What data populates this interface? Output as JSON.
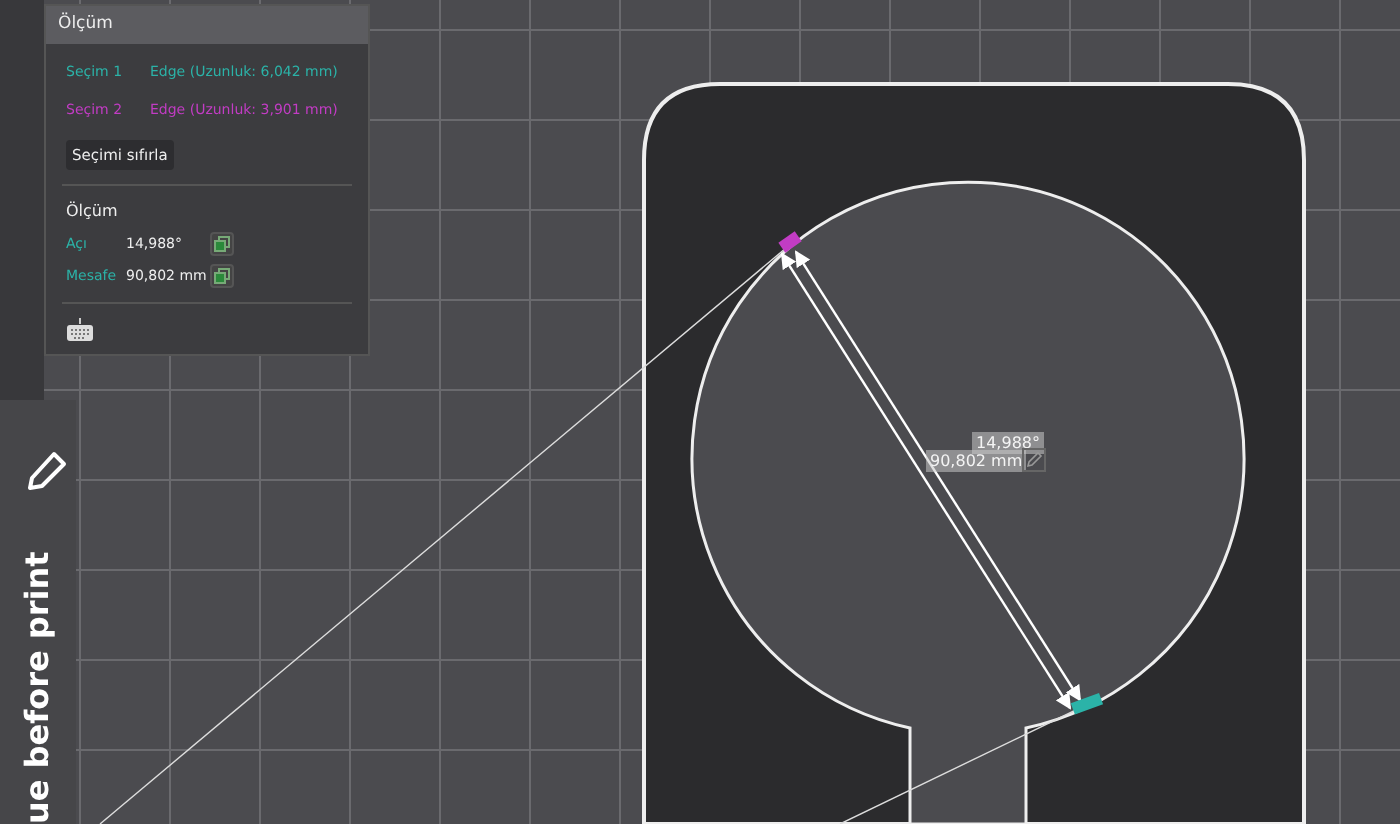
{
  "panel": {
    "title": "Ölçüm",
    "selections": [
      {
        "label": "Seçim 1",
        "value": "Edge (Uzunluk: 6,042 mm)",
        "color": "#2bb3a8"
      },
      {
        "label": "Seçim 2",
        "value": "Edge (Uzunluk: 3,901 mm)",
        "color": "#c23cc4"
      }
    ],
    "reset_button": "Seçimi sıfırla",
    "section_title": "Ölçüm",
    "measurements": [
      {
        "label": "Açı",
        "value": "14,988°"
      },
      {
        "label": "Mesafe",
        "value": "90,802 mm"
      }
    ]
  },
  "canvas_labels": {
    "angle": "14,988°",
    "distance": "90,802 mm"
  },
  "side_banner": "ue before print"
}
